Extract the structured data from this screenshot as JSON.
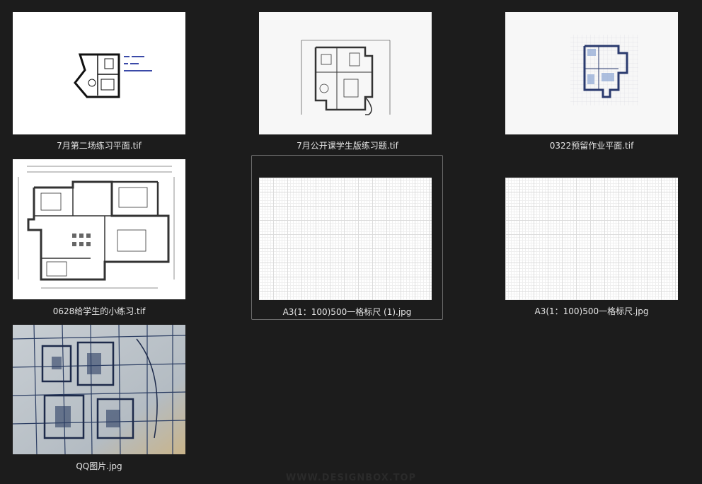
{
  "files": [
    {
      "name": "7月第二场练习平面.tif"
    },
    {
      "name": "7月公开课学生版练习题.tif"
    },
    {
      "name": "0322预留作业平面.tif"
    },
    {
      "name": "0628给学生的小练习.tif"
    },
    {
      "name": "A3(1：100)500一格标尺 (1).jpg"
    },
    {
      "name": "A3(1：100)500一格标尺.jpg"
    },
    {
      "name": "QQ图片.jpg"
    }
  ],
  "selected_index": 4,
  "watermark": "WWW.DESIGNBOX.TOP"
}
